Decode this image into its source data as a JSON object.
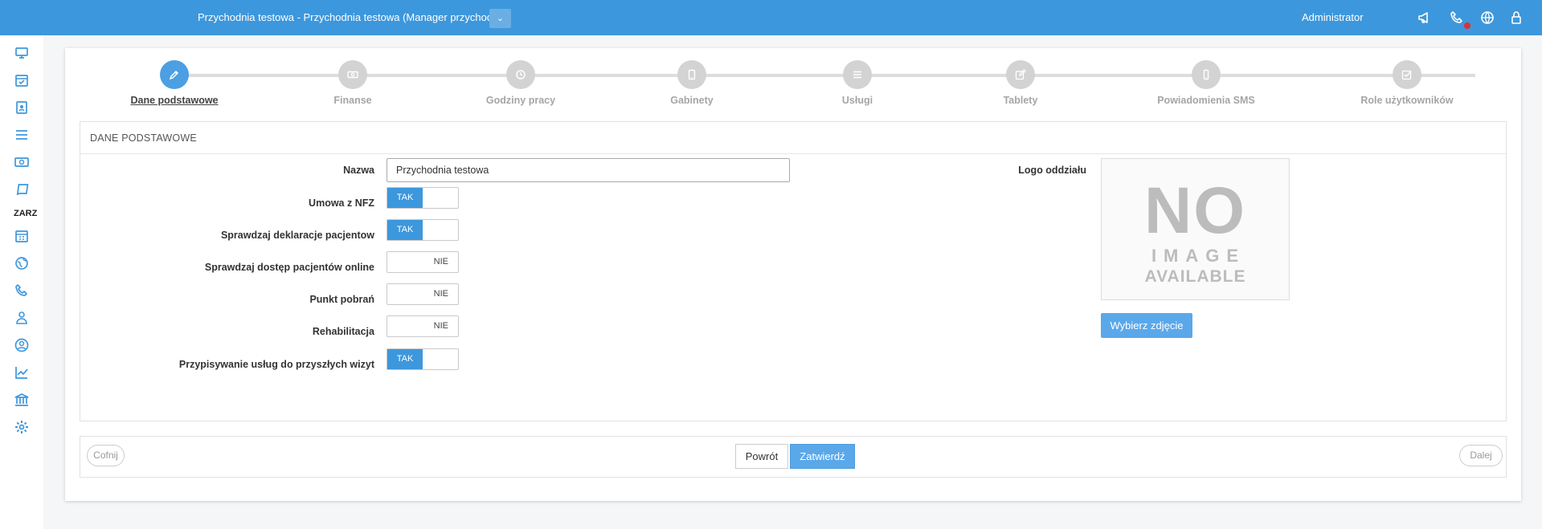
{
  "topbar": {
    "clinic_title": "Przychodnia testowa - Przychodnia testowa (Manager przychodni)",
    "dropdown_glyph": "⌄",
    "user_name": "Administrator",
    "icons": [
      "megaphone-icon",
      "phone-icon",
      "globe-icon",
      "lock-icon"
    ],
    "notification_color": "#e03030"
  },
  "sidebar": {
    "section_label": "ZARZ",
    "icons": [
      "monitor-icon",
      "calendar-check-icon",
      "contact-book-icon",
      "list-icon",
      "money-icon",
      "book-icon",
      "calendar-icon",
      "globe-icon",
      "phone-icon",
      "users-icon",
      "user-circle-icon",
      "chart-line-icon",
      "bank-icon",
      "gear-icon"
    ]
  },
  "wizard": {
    "steps": [
      {
        "label": "Dane podstawowe",
        "icon": "pencil-icon",
        "active": true
      },
      {
        "label": "Finanse",
        "icon": "money-icon",
        "active": false
      },
      {
        "label": "Godziny pracy",
        "icon": "clock-icon",
        "active": false
      },
      {
        "label": "Gabinety",
        "icon": "tablet-icon",
        "active": false
      },
      {
        "label": "Usługi",
        "icon": "list-icon",
        "active": false
      },
      {
        "label": "Tablety",
        "icon": "edit-icon",
        "active": false
      },
      {
        "label": "Powiadomienia SMS",
        "icon": "mobile-icon",
        "active": false
      },
      {
        "label": "Role użytkowników",
        "icon": "check-square-icon",
        "active": false
      }
    ]
  },
  "form": {
    "section_title": "DANE PODSTAWOWE",
    "name_label": "Nazwa",
    "name_value": "Przychodnia testowa",
    "toggles": [
      {
        "label": "Umowa z NFZ",
        "value": "TAK",
        "on": true
      },
      {
        "label": "Sprawdzaj deklaracje pacjentow",
        "value": "TAK",
        "on": true
      },
      {
        "label": "Sprawdzaj dostęp pacjentów online",
        "value": "NIE",
        "on": false
      },
      {
        "label": "Punkt pobrań",
        "value": "NIE",
        "on": false
      },
      {
        "label": "Rehabilitacja",
        "value": "NIE",
        "on": false
      },
      {
        "label": "Przypisywanie usług do przyszłych wizyt",
        "value": "TAK",
        "on": true
      }
    ],
    "logo_label": "Logo oddziału",
    "no_image": {
      "line1": "NO",
      "line2": "IMAGE",
      "line3": "AVAILABLE"
    },
    "pick_image_label": "Wybierz zdjęcie"
  },
  "footer": {
    "prev_label": "Cofnij",
    "back_label": "Powrót",
    "submit_label": "Zatwierdź",
    "next_label": "Dalej"
  },
  "colors": {
    "accent": "#3d97dc",
    "button": "#5aa8ea",
    "inactive_step": "#d3d3d3"
  }
}
